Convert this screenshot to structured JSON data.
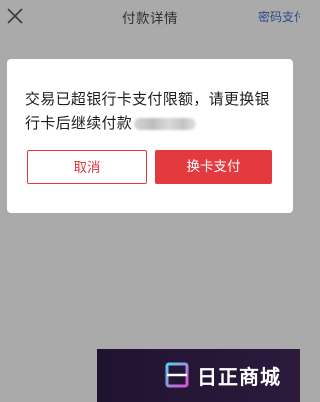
{
  "header": {
    "title": "付款详情",
    "right_link": "密码支付",
    "back_icon": "close-icon"
  },
  "dialog": {
    "message": "交易已超银行卡支付限额，请更换银行卡后继续付款",
    "cancel_label": "取消",
    "switch_card_label": "换卡支付"
  },
  "watermark": {
    "logo_icon": "brand-logo-icon",
    "text": "日正商城"
  },
  "colors": {
    "accent": "#e23a3e",
    "background_dim": "#aaaaaa",
    "link": "#2a4a86"
  }
}
